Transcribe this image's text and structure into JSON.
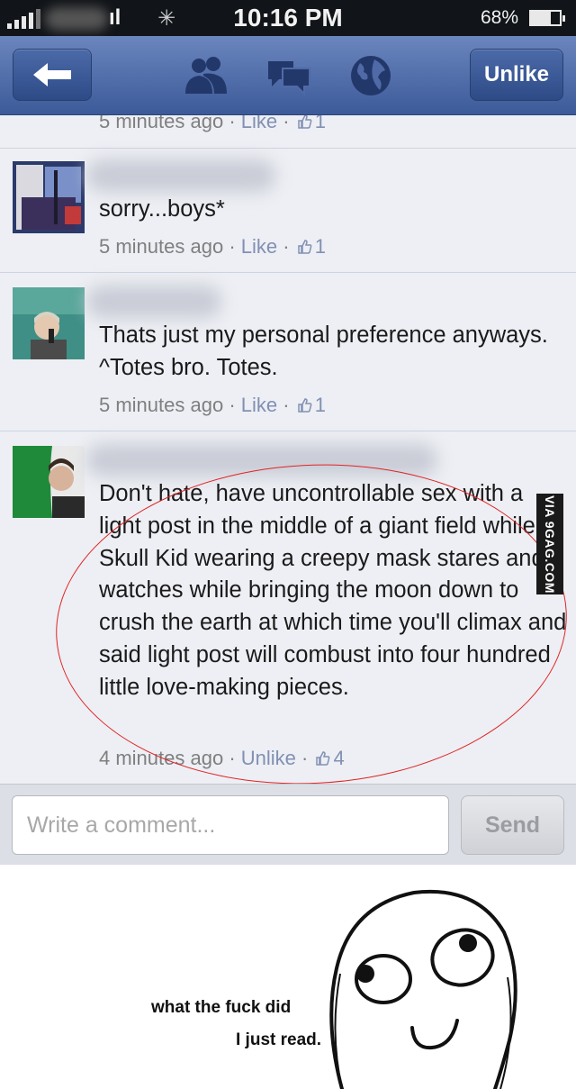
{
  "status_bar": {
    "network": "ıl",
    "time": "10:16 PM",
    "battery": "68%",
    "battery_level": 0.68
  },
  "nav": {
    "unlike_label": "Unlike",
    "icons": [
      "back-arrow-icon",
      "friends-icon",
      "messages-icon",
      "notifications-globe-icon"
    ]
  },
  "feed": {
    "top_meta": {
      "time": "5 minutes ago",
      "action": "Like",
      "likes": "1"
    },
    "comments": [
      {
        "text": "sorry...boys*",
        "time": "5 minutes ago",
        "action": "Like",
        "likes": "1"
      },
      {
        "text": "Thats just my personal preference anyways. ^Totes bro. Totes.",
        "time": "5 minutes ago",
        "action": "Like",
        "likes": "1"
      },
      {
        "text": "Don't hate, have uncontrollable sex with a light post in the middle of a giant field while a Skull Kid wearing a creepy mask stares and watches while bringing the moon down to crush the earth at which time you'll climax and said light post will combust into four hundred little love-making pieces.",
        "time": "4 minutes ago",
        "action": "Unlike",
        "likes": "4"
      }
    ],
    "watermark": "VIA 9GAG.COM"
  },
  "compose": {
    "placeholder": "Write a comment...",
    "send_label": "Send"
  },
  "rage_comic": {
    "line1": "what the fuck did",
    "line2": "I just read."
  },
  "colors": {
    "nav_blue": "#3c5a99",
    "feed_bg": "#edeff4",
    "link": "#8190b3",
    "meta": "#7f7f7f",
    "ellipse": "#e02424"
  }
}
